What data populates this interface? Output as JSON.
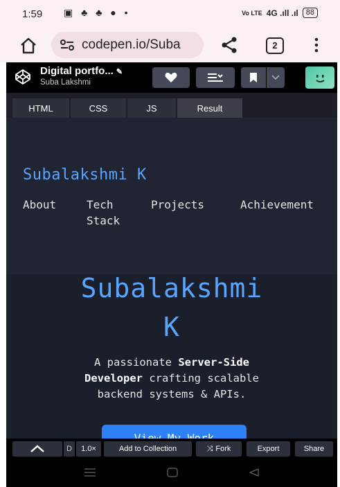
{
  "status_bar": {
    "time": "1:59",
    "notifications": "▣ ♣ ♣ ● •",
    "network": "Vo LTE",
    "signal": "4G .ıll .ıl",
    "battery": "88"
  },
  "browser": {
    "url": "codepen.io/Suba",
    "tab_count": "2"
  },
  "codepen": {
    "pen_title": "Digital portfo...",
    "author": "Suba Lakshmi",
    "editor_tabs": [
      "HTML",
      "CSS",
      "JS",
      "Result"
    ],
    "active_tab": "Result"
  },
  "site": {
    "logo": "Subalakshmi K",
    "nav": [
      {
        "line1": "About",
        "line2": ""
      },
      {
        "line1": "Tech",
        "line2": "Stack"
      },
      {
        "line1": "Projects",
        "line2": ""
      },
      {
        "line1": "Achievement",
        "line2": ""
      }
    ],
    "hero_title_line1": "Subalakshmi",
    "hero_title_line2": "K",
    "subtitle_part1": "A passionate ",
    "subtitle_bold1": "Server-Side",
    "subtitle_bold2": "Developer",
    "subtitle_part2": " crafting scalable",
    "subtitle_line3": "backend systems & APIs.",
    "cta": "View My Work"
  },
  "footer": {
    "collapse_label": "D",
    "zoom": "1.0×",
    "add_to_collection": "Add to Collection",
    "fork": "Fork",
    "export": "Export",
    "share": "Share"
  },
  "colors": {
    "accent": "#58a6ff",
    "cta": "#2f81f7",
    "preview_bg": "#1b1e2b"
  }
}
